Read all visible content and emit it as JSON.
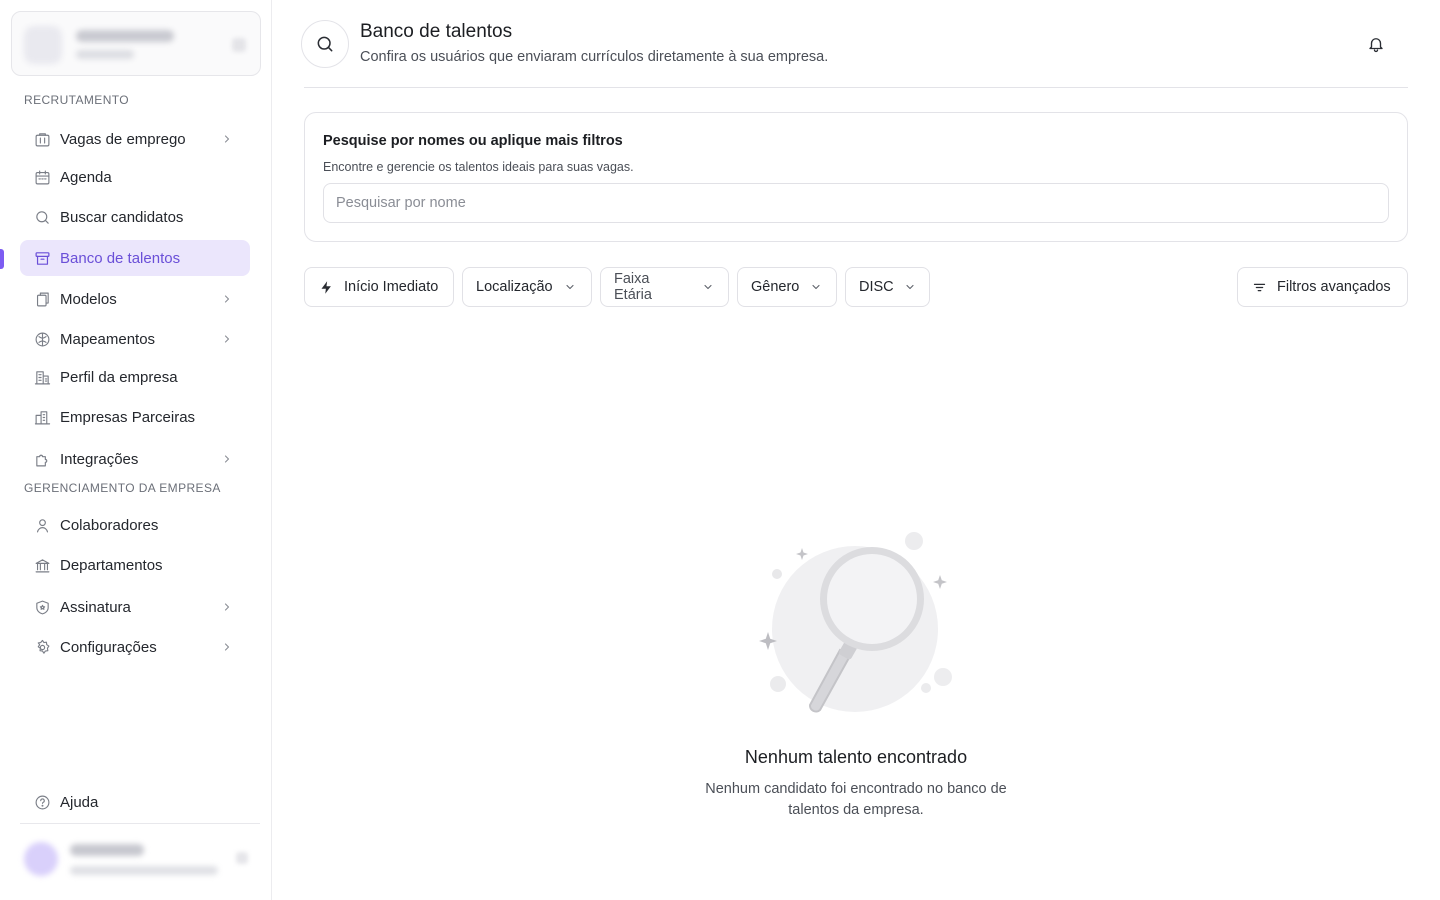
{
  "sidebar": {
    "section_recruitment": "RECRUTAMENTO",
    "section_management": "GERENCIAMENTO DA EMPRESA",
    "items": [
      {
        "label": "Vagas de emprego"
      },
      {
        "label": "Agenda"
      },
      {
        "label": "Buscar candidatos"
      },
      {
        "label": "Banco de talentos"
      },
      {
        "label": "Modelos"
      },
      {
        "label": "Mapeamentos"
      },
      {
        "label": "Perfil da empresa"
      },
      {
        "label": "Empresas Parceiras"
      },
      {
        "label": "Integrações"
      },
      {
        "label": "Colaboradores"
      },
      {
        "label": "Departamentos"
      },
      {
        "label": "Assinatura"
      },
      {
        "label": "Configurações"
      },
      {
        "label": "Ajuda"
      }
    ],
    "active_item": "Banco de talentos"
  },
  "header": {
    "title": "Banco de talentos",
    "subtitle": "Confira os usuários que enviaram currículos diretamente à sua empresa."
  },
  "search_card": {
    "title": "Pesquise por nomes ou aplique mais filtros",
    "subtitle": "Encontre e gerencie os talentos ideais para suas vagas.",
    "placeholder": "Pesquisar por nome"
  },
  "filters": {
    "immediate": "Início Imediato",
    "location": "Localização",
    "age_range": "Faixa Etária",
    "gender": "Gênero",
    "disc": "DISC",
    "advanced": "Filtros avançados"
  },
  "empty_state": {
    "title": "Nenhum talento encontrado",
    "description": "Nenhum candidato foi encontrado no banco de talentos da empresa."
  },
  "colors": {
    "accent": "#6a4fd8",
    "active_bg": "#ebe6fc",
    "border": "#e3e3e8"
  }
}
